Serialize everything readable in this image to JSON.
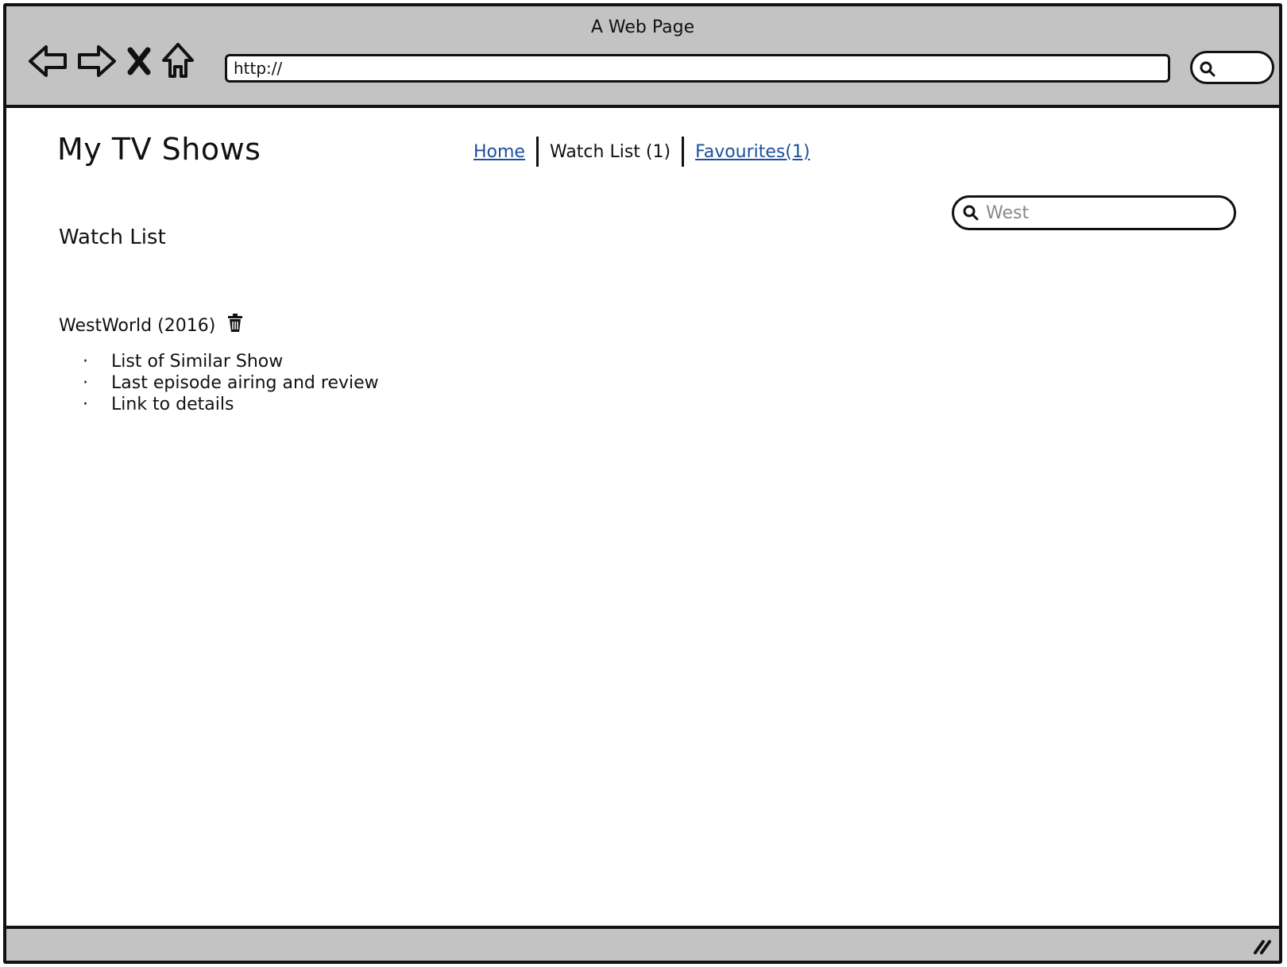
{
  "browser": {
    "window_title": "A Web Page",
    "url": "http://"
  },
  "site": {
    "title": "My TV Shows",
    "nav": {
      "home": "Home",
      "watch_list": "Watch List (1)",
      "favourites": "Favourites(1)"
    },
    "search": {
      "value": "West"
    }
  },
  "watch_list": {
    "heading": "Watch List",
    "shows": [
      {
        "title": "WestWorld (2016)",
        "details": [
          "List of Similar Show",
          "Last episode airing and review",
          "Link to details"
        ]
      }
    ]
  },
  "icons": {
    "back": "back-arrow-icon",
    "forward": "forward-arrow-icon",
    "stop": "close-icon",
    "home": "home-icon",
    "search": "search-icon",
    "delete": "trash-icon"
  },
  "colors": {
    "chrome": "#c3c3c3",
    "link": "#1b4f9c"
  }
}
